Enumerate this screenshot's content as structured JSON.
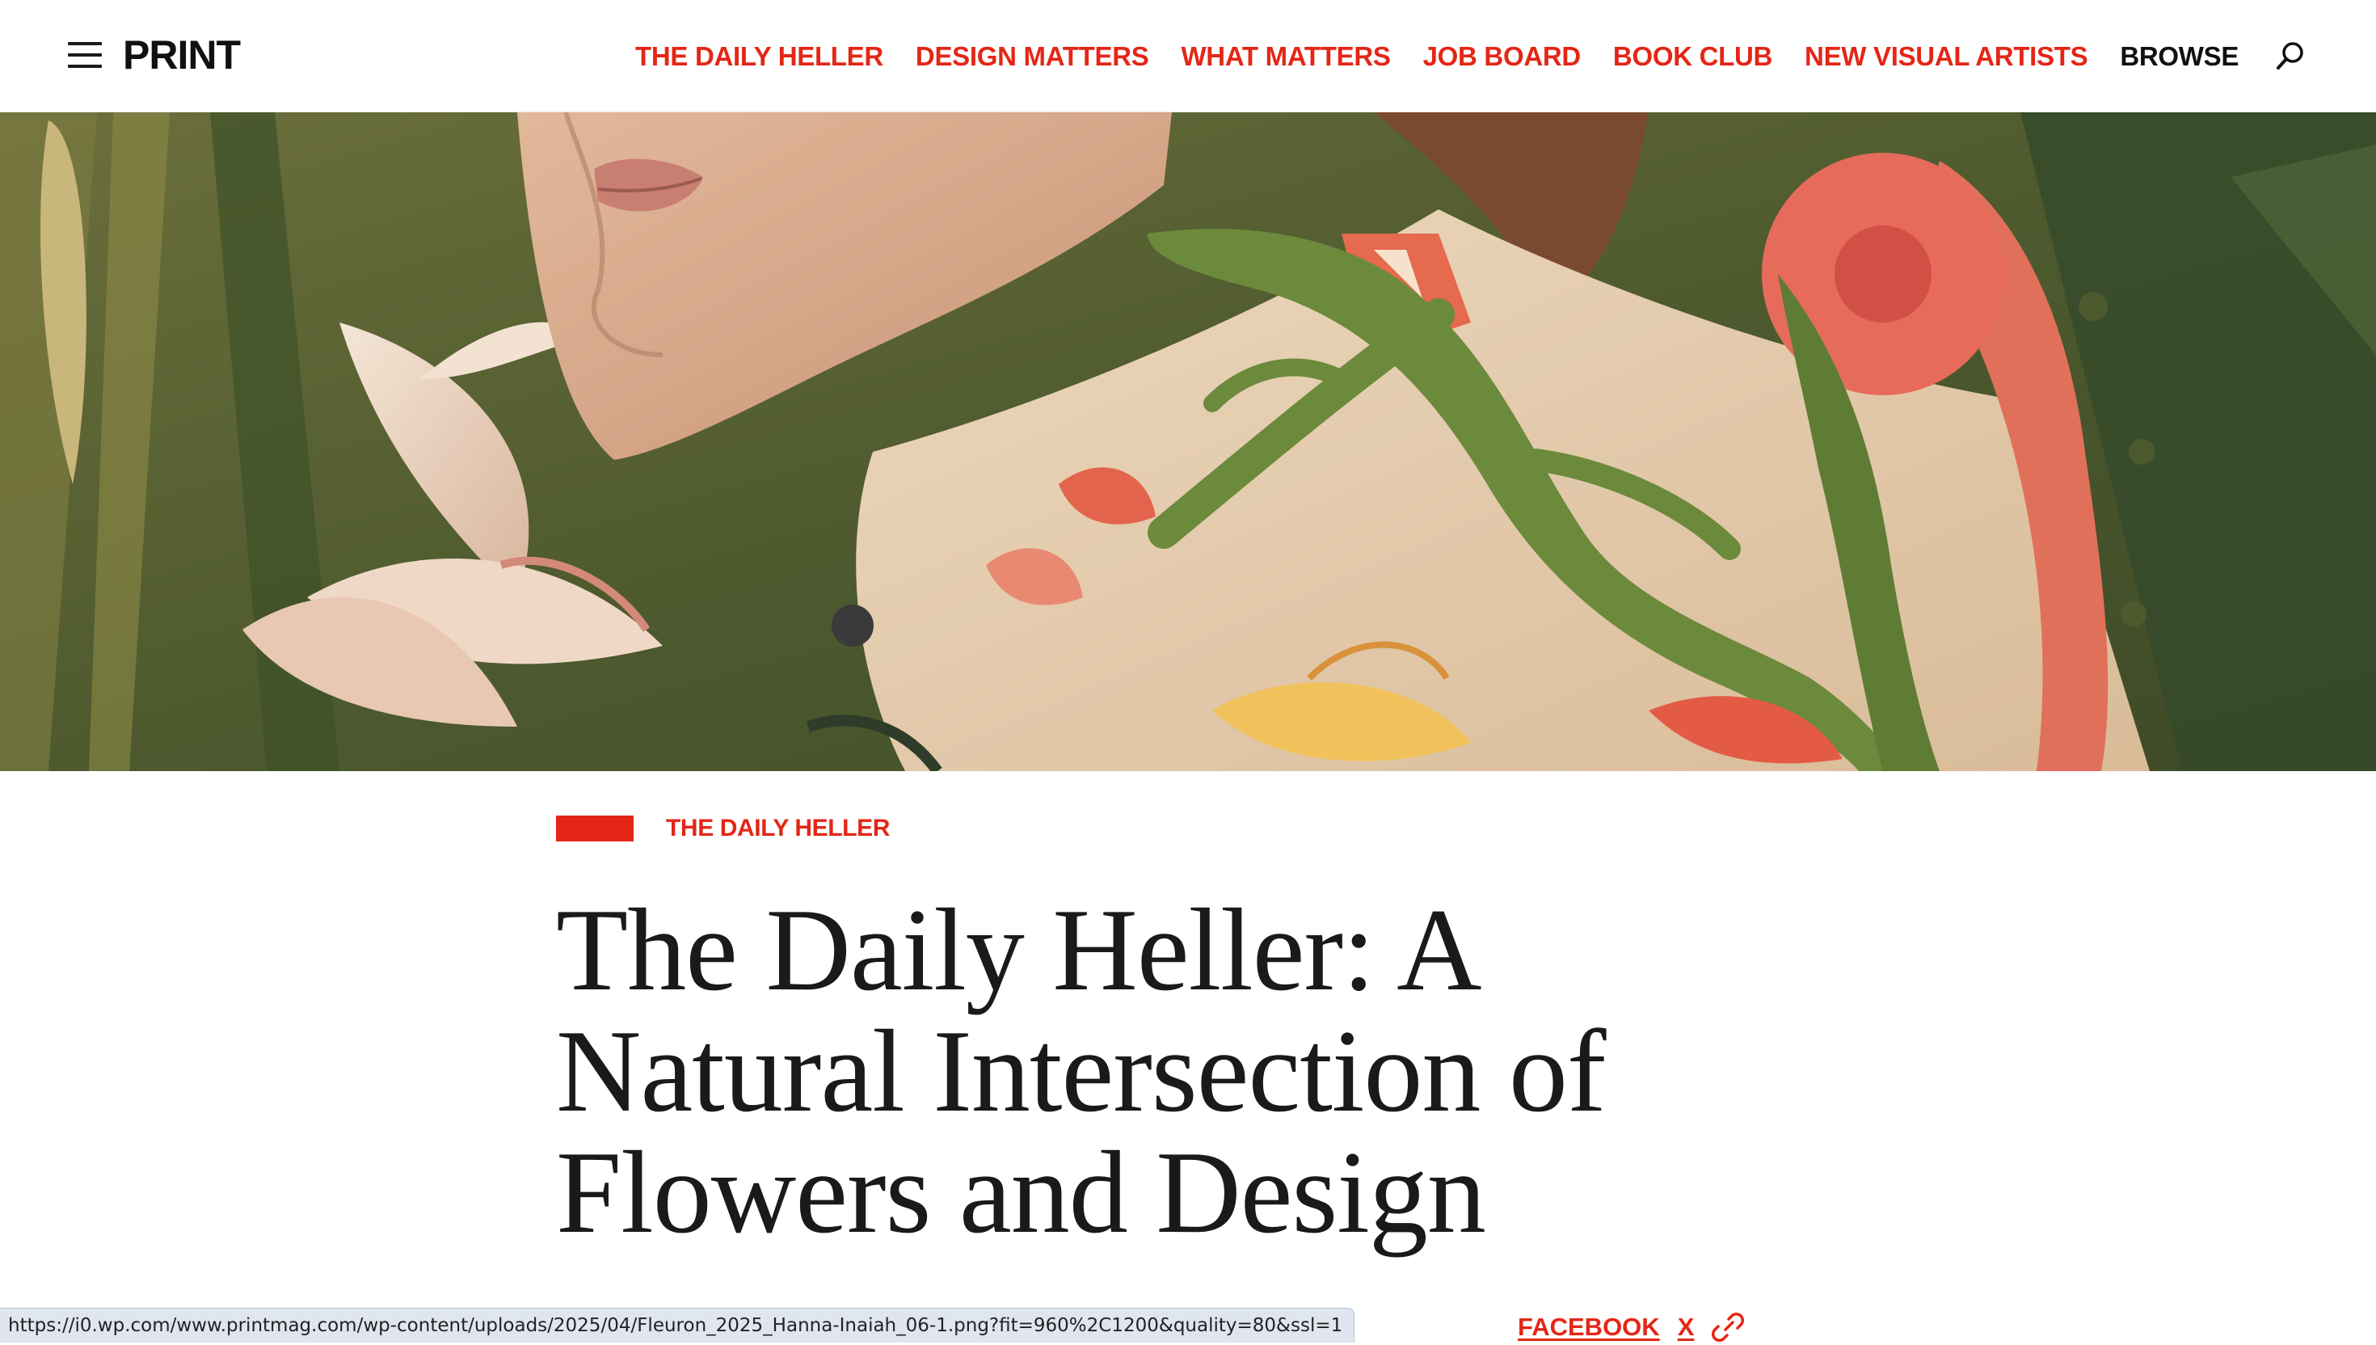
{
  "header": {
    "logo": "PRINT",
    "nav": [
      {
        "label": "THE DAILY HELLER"
      },
      {
        "label": "DESIGN MATTERS"
      },
      {
        "label": "WHAT MATTERS"
      },
      {
        "label": "JOB BOARD"
      },
      {
        "label": "BOOK CLUB"
      },
      {
        "label": "NEW VISUAL ARTISTS"
      },
      {
        "label": "BROWSE"
      }
    ],
    "menu_icon": "hamburger-menu-icon",
    "search_icon": "search-icon"
  },
  "hero": {
    "icon": "hero-image"
  },
  "article": {
    "category": "THE DAILY HELLER",
    "title": "The Daily Heller: A Natural Intersection of Flowers and Design"
  },
  "share": {
    "facebook": "FACEBOOK",
    "x": "X",
    "link_icon": "link-icon"
  },
  "status_bar": {
    "url": "https://i0.wp.com/www.printmag.com/wp-content/uploads/2025/04/Fleuron_2025_Hanna-Inaiah_06-1.png?fit=960%2C1200&quality=80&ssl=1"
  },
  "colors": {
    "accent": "#e42616",
    "text": "#1a1a1a",
    "background": "#ffffff"
  }
}
